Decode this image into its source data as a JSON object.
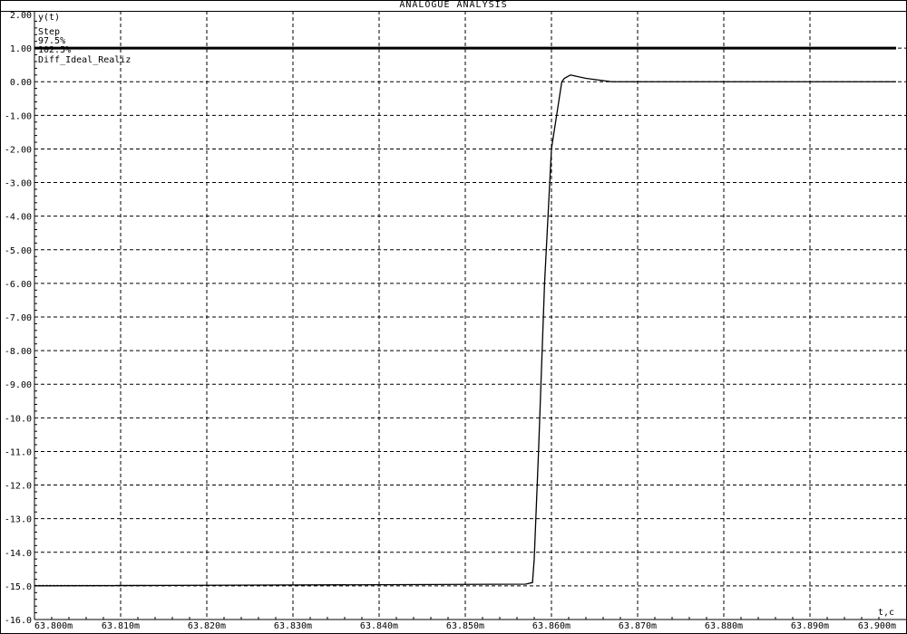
{
  "window_title": "ANALOGUE ANALYSIS",
  "chart_data": {
    "type": "line",
    "title": "ANALOGUE ANALYSIS",
    "xlabel": "t,c",
    "ylabel": "y(t)",
    "xlim": [
      63.8,
      63.9
    ],
    "ylim": [
      -16.0,
      2.0
    ],
    "grid": true,
    "xticks": [
      "63.800m",
      "63.810m",
      "63.820m",
      "63.830m",
      "63.840m",
      "63.850m",
      "63.860m",
      "63.870m",
      "63.880m",
      "63.890m",
      "63.900m"
    ],
    "yticks": [
      "2.00",
      "1.00",
      "0.00",
      "-1.00",
      "-2.00",
      "-3.00",
      "-4.00",
      "-5.00",
      "-6.00",
      "-7.00",
      "-8.00",
      "-9.00",
      "-10.0",
      "-11.0",
      "-12.0",
      "-13.0",
      "-14.0",
      "-15.0",
      "-16.0"
    ],
    "legend": [
      "y(t)",
      "Step",
      "97.5%",
      "102.5%",
      "Diff_Ideal_Realiz"
    ],
    "series": [
      {
        "name": "Step",
        "x": [
          63.8,
          63.9
        ],
        "y": [
          1.0,
          1.0
        ]
      },
      {
        "name": "Diff_Ideal_Realiz",
        "x": [
          63.8,
          63.857,
          63.8578,
          63.858,
          63.8585,
          63.8592,
          63.8597,
          63.86,
          63.8606,
          63.8612,
          63.8615,
          63.8622,
          63.864,
          63.867,
          63.9
        ],
        "y": [
          -15.0,
          -14.95,
          -14.9,
          -14.2,
          -11.0,
          -6.0,
          -3.5,
          -2.0,
          -1.0,
          0.0,
          0.1,
          0.2,
          0.1,
          0.0,
          0.0
        ]
      }
    ]
  }
}
